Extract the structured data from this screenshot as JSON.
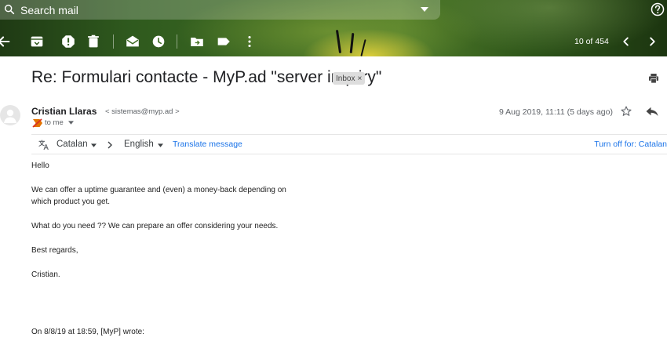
{
  "search": {
    "placeholder": "Search mail"
  },
  "icons": {
    "search": "search-icon",
    "search_options": "caret-down-icon",
    "help": "help-circle-icon",
    "back": "arrow-left-icon",
    "archive": "archive-icon",
    "spam": "report-spam-icon",
    "delete": "trash-icon",
    "mark_unread": "mark-unread-icon",
    "snooze": "clock-icon",
    "move_to": "folder-move-icon",
    "labels": "label-icon",
    "more": "more-vertical-icon",
    "older": "chevron-left-icon",
    "newer": "chevron-right-icon",
    "print": "printer-icon",
    "star": "star-outline-icon",
    "reply": "reply-icon",
    "important": "important-marker-icon",
    "translate": "translate-icon"
  },
  "pager": {
    "count": "10 of 454"
  },
  "message": {
    "subject": "Re: Formulari contacte - MyP.ad \"server inquiry\"",
    "label": "Inbox",
    "label_remove": "×",
    "sender_name": "Cristian Llaras",
    "sender_email": "< sistemas@myp.ad >",
    "recipient": "to me",
    "date": "9 Aug 2019, 11:11 (5 days ago)"
  },
  "translate": {
    "source_lang": "Catalan",
    "target_lang": "English",
    "translate_link": "Translate message",
    "turn_off": "Turn off for: Catalan"
  },
  "body": {
    "greeting": "Hello",
    "para1_line1": "We can offer a uptime guarantee and (even) a money-back depending on",
    "para1_line2": "which product you get.",
    "para2": "What do you need ?? We can prepare an offer considering your needs.",
    "signoff": "Best regards,",
    "signature": "Cristian.",
    "quote_header": "On 8/8/19 at 18:59, [MyP] wrote:"
  },
  "colors": {
    "link": "#1a73e8",
    "important": "#d93025",
    "text": "#202124",
    "muted": "#5f6368"
  }
}
